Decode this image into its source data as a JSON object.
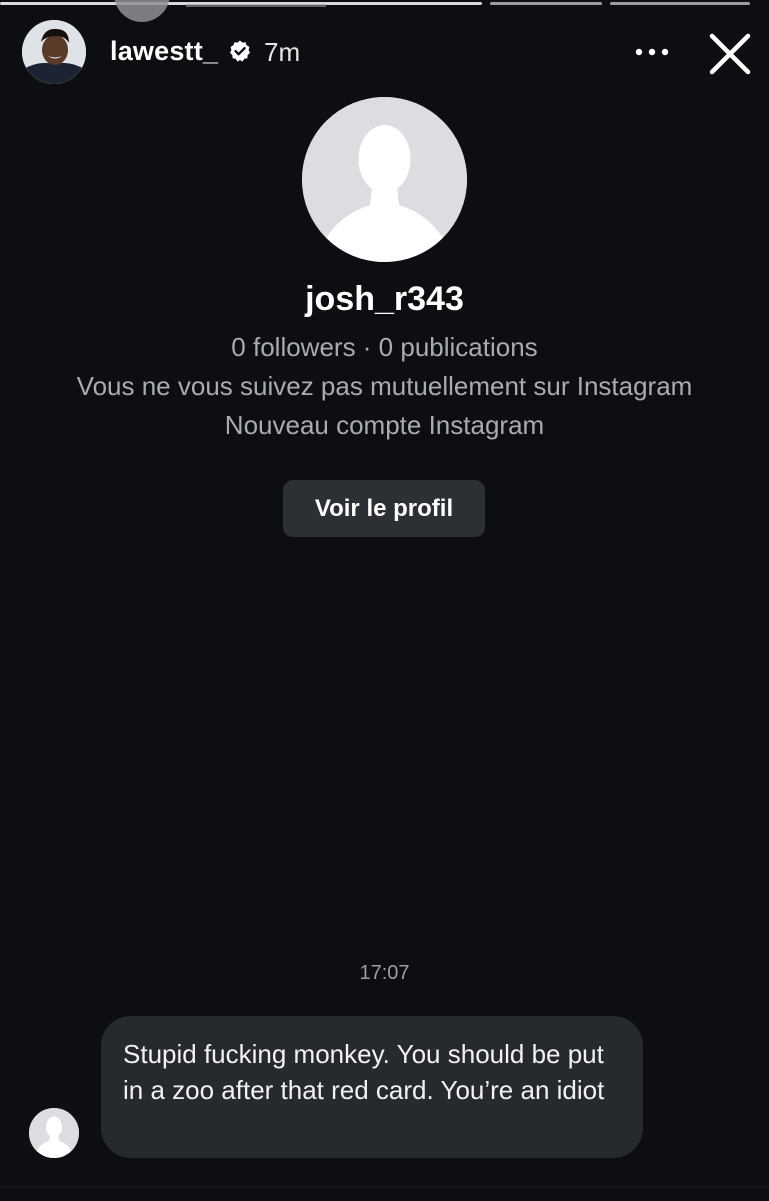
{
  "story": {
    "username": "lawestt_",
    "time_ago": "7m",
    "verified_icon": "verified-badge-icon",
    "more_icon": "more-dots-icon",
    "close_icon": "close-icon"
  },
  "profile": {
    "username": "josh_r343",
    "stats": "0 followers · 0 publications",
    "mutual_note": "Vous ne vous suivez pas mutuellement sur Instagram",
    "account_note": "Nouveau compte Instagram",
    "view_profile_label": "Voir le profil",
    "avatar_icon": "default-avatar-icon"
  },
  "message": {
    "timestamp": "17:07",
    "text": "Stupid fucking monkey. You should be put in a zoo after that red card. You’re an idiot",
    "sender_avatar_icon": "default-avatar-icon"
  },
  "colors": {
    "background": "#0c0e12",
    "bubble": "#26292e",
    "button": "#2c2f34",
    "secondary_text": "#a8abb0"
  }
}
